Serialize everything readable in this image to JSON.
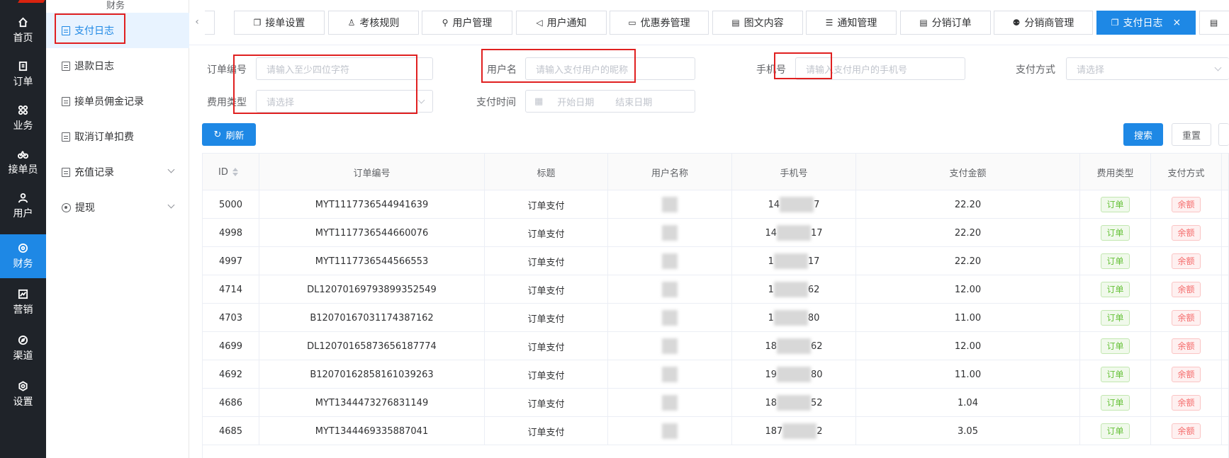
{
  "leftnav": {
    "items": [
      {
        "label": "首页",
        "icon": "home-icon"
      },
      {
        "label": "订单",
        "icon": "order-icon"
      },
      {
        "label": "业务",
        "icon": "grid-icon"
      },
      {
        "label": "接单员",
        "icon": "bike-icon"
      },
      {
        "label": "用户",
        "icon": "user-icon"
      },
      {
        "label": "财务",
        "icon": "finance-icon"
      },
      {
        "label": "营销",
        "icon": "chart-icon"
      },
      {
        "label": "渠道",
        "icon": "compass-icon"
      },
      {
        "label": "设置",
        "icon": "gear-icon"
      }
    ],
    "active_color": "#1e88e5"
  },
  "subnav": {
    "title": "财务",
    "items": [
      {
        "label": "支付日志"
      },
      {
        "label": "退款日志"
      },
      {
        "label": "接单员佣金记录"
      },
      {
        "label": "取消订单扣费"
      },
      {
        "label": "充值记录"
      },
      {
        "label": "提现"
      }
    ]
  },
  "tabs": [
    {
      "label": "接单设置",
      "icon": "copy-icon"
    },
    {
      "label": "考核规则",
      "icon": "rule-icon"
    },
    {
      "label": "用户管理",
      "icon": "user-icon"
    },
    {
      "label": "用户通知",
      "icon": "speaker-icon"
    },
    {
      "label": "优惠券管理",
      "icon": "coupon-icon"
    },
    {
      "label": "图文内容",
      "icon": "doc-icon"
    },
    {
      "label": "通知管理",
      "icon": "list-icon"
    },
    {
      "label": "分销订单",
      "icon": "doc-icon"
    },
    {
      "label": "分销商管理",
      "icon": "team-icon"
    },
    {
      "label": "支付日志",
      "icon": "copy-icon",
      "close": "×"
    }
  ],
  "filters": {
    "order_no_label": "订单编号",
    "order_no_placeholder": "请输入至少四位字符",
    "username_label": "用户名",
    "username_placeholder": "请输入支付用户的昵称",
    "phone_label": "手机号",
    "phone_placeholder": "请输入支付用户的手机号",
    "pay_method_label": "支付方式",
    "pay_method_placeholder": "请选择",
    "fee_type_label": "费用类型",
    "fee_type_placeholder": "请选择",
    "pay_time_label": "支付时间",
    "start_date_placeholder": "开始日期",
    "end_date_placeholder": "结束日期"
  },
  "buttons": {
    "refresh": "刷新",
    "search": "搜索",
    "reset": "重置"
  },
  "table": {
    "headers": [
      "ID",
      "订单编号",
      "标题",
      "用户名称",
      "手机号",
      "支付金额",
      "费用类型",
      "支付方式"
    ],
    "rows": [
      {
        "id": "5000",
        "order_no": "MYT1117736544941639",
        "title": "订单支付",
        "phone_start": "14",
        "phone_end": "7",
        "amount": "22.20",
        "fee_type": "订单",
        "pay_method": "余额"
      },
      {
        "id": "4998",
        "order_no": "MYT1117736544660076",
        "title": "订单支付",
        "phone_start": "14",
        "phone_end": "17",
        "amount": "22.20",
        "fee_type": "订单",
        "pay_method": "余额"
      },
      {
        "id": "4997",
        "order_no": "MYT1117736544566553",
        "title": "订单支付",
        "phone_start": "1",
        "phone_end": "17",
        "amount": "22.20",
        "fee_type": "订单",
        "pay_method": "余额"
      },
      {
        "id": "4714",
        "order_no": "DL12070169793899352549",
        "title": "订单支付",
        "phone_start": "1",
        "phone_end": "62",
        "amount": "12.00",
        "fee_type": "订单",
        "pay_method": "余额"
      },
      {
        "id": "4703",
        "order_no": "B12070167031174387162",
        "title": "订单支付",
        "phone_start": "1",
        "phone_end": "80",
        "amount": "11.00",
        "fee_type": "订单",
        "pay_method": "余额"
      },
      {
        "id": "4699",
        "order_no": "DL12070165873656187774",
        "title": "订单支付",
        "phone_start": "18",
        "phone_end": "62",
        "amount": "12.00",
        "fee_type": "订单",
        "pay_method": "余额"
      },
      {
        "id": "4692",
        "order_no": "B12070162858161039263",
        "title": "订单支付",
        "phone_start": "19",
        "phone_end": "80",
        "amount": "11.00",
        "fee_type": "订单",
        "pay_method": "余额"
      },
      {
        "id": "4686",
        "order_no": "MYT1344473276831149",
        "title": "订单支付",
        "phone_start": "18",
        "phone_end": "52",
        "amount": "1.04",
        "fee_type": "订单",
        "pay_method": "余额"
      },
      {
        "id": "4685",
        "order_no": "MYT1344469335887041",
        "title": "订单支付",
        "phone_start": "187",
        "phone_end": "2",
        "amount": "3.05",
        "fee_type": "订单",
        "pay_method": "余额"
      }
    ]
  }
}
